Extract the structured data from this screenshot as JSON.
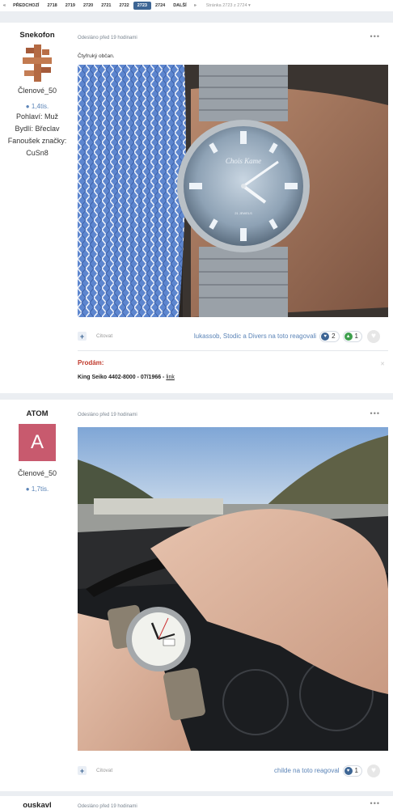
{
  "pagination": {
    "prev_icon": "«",
    "prev_label": "PŘEDCHOZÍ",
    "pages": [
      "2718",
      "2719",
      "2720",
      "2721",
      "2722",
      "2723",
      "2724"
    ],
    "active_page": "2723",
    "next_label": "DALŠÍ",
    "next_icon": "»",
    "jump_label": "Stránka 2723 z 2724 ▾"
  },
  "posts": [
    {
      "author": "Snekofon",
      "group": "Členové_50",
      "reputation": "1,4tis.",
      "gender": "Pohlaví: Muž",
      "location": "Bydlí: Břeclav",
      "fan": "Fanoušek značky:",
      "fan_value": "CuSn8",
      "posted": "Odesláno před 19 hodinami",
      "more": "•••",
      "text": "Čtyřruký občan.",
      "quote_label": "Citovat",
      "reacted_by": "lukassob, Stodic a Divers na toto reagovali",
      "reaction_like_count": "2",
      "reaction_up_count": "1",
      "sig_heading": "Prodám:",
      "sig_text": "King Seiko 4402-8000 - 07/1966 - ",
      "sig_link": "link",
      "watch_brand": "Chois Kame",
      "watch_sub": "21 JEWELS"
    },
    {
      "author": "ATOM",
      "avatar_letter": "A",
      "group": "Členové_50",
      "reputation": "1,7tis.",
      "posted": "Odesláno před 19 hodinami",
      "more": "•••",
      "quote_label": "Citovat",
      "reacted_by": "childe na toto reagoval",
      "reaction_like_count": "1"
    },
    {
      "author": "ouskavl",
      "posted": "Odesláno před 19 hodinami",
      "more": "•••"
    }
  ],
  "colors": {
    "accent": "#3d6594",
    "avatar_bg": "#c85a6e",
    "signature_red": "#c0392b"
  }
}
